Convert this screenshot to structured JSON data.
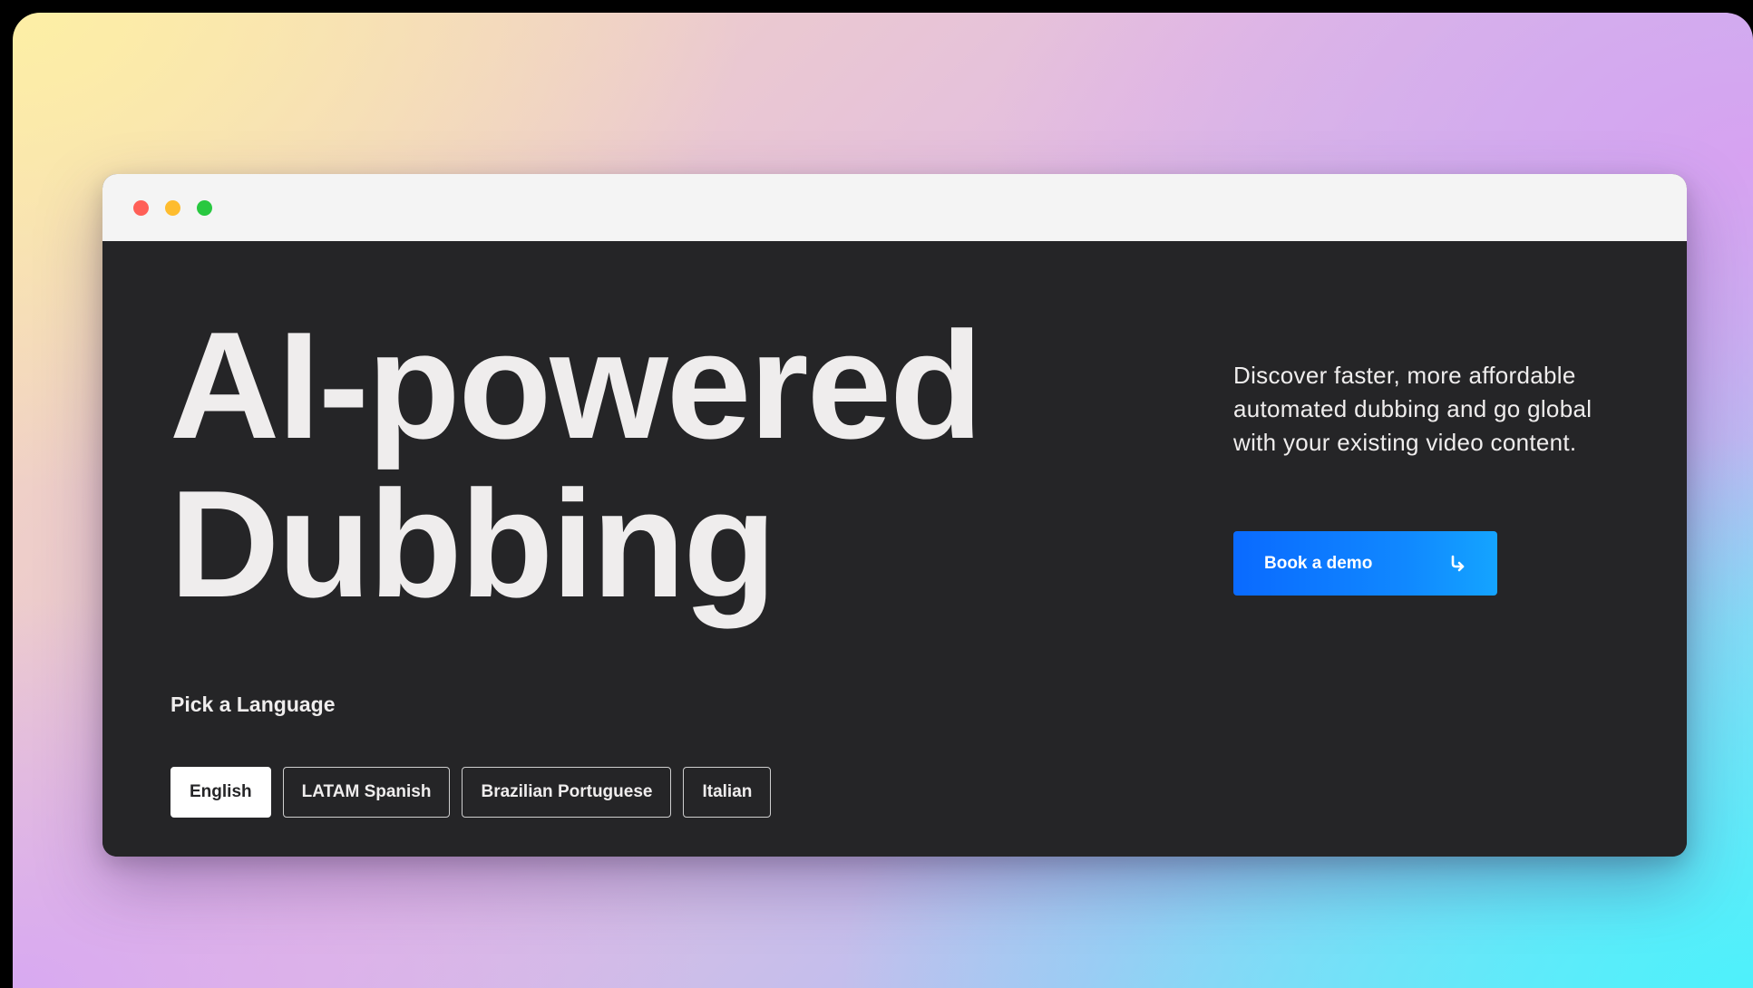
{
  "hero": {
    "headline_line1": "AI-powered",
    "headline_line2": "Dubbing",
    "description": "Discover faster, more affordable automated dubbing and go global with your existing video content.",
    "cta_label": "Book a demo",
    "cta_icon": "arrow-turn-down-right-icon"
  },
  "languages": {
    "label": "Pick a Language",
    "selected": "English",
    "options": [
      {
        "label": "English"
      },
      {
        "label": "LATAM Spanish"
      },
      {
        "label": "Brazilian Portuguese"
      },
      {
        "label": "Italian"
      }
    ]
  },
  "colors": {
    "page_background": "#252527",
    "text": "#efeded",
    "accent": "#0a6aff",
    "titlebar": "#f4f4f4"
  }
}
